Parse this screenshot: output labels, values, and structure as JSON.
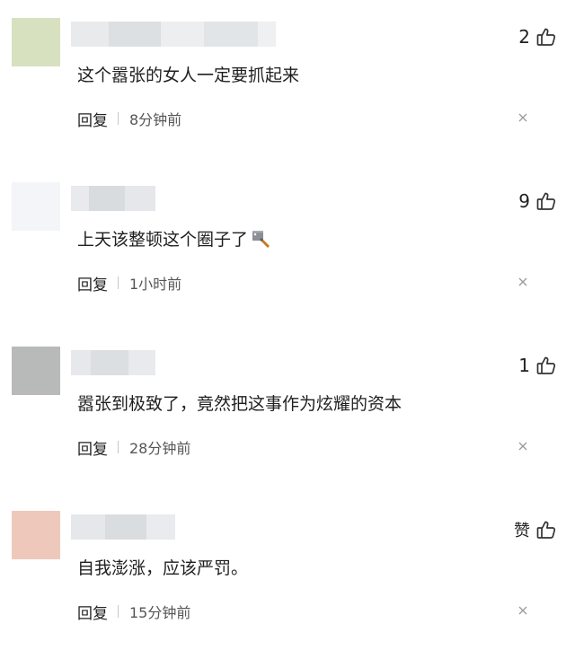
{
  "reply_label": "回复",
  "comments": [
    {
      "text": "这个嚣张的女人一定要抓起来",
      "time": "8分钟前",
      "likes": "2",
      "avatar_color": "#d7e1bf"
    },
    {
      "text": "上天该整顿这个圈子了",
      "time": "1小时前",
      "likes": "9",
      "avatar_color": "#f4f5f8"
    },
    {
      "text": "嚣张到极致了，竟然把这事作为炫耀的资本",
      "time": "28分钟前",
      "likes": "1",
      "avatar_color": "#b8b9b9"
    },
    {
      "text": "自我澎涨，应该严罚。",
      "time": "15分钟前",
      "likes": "赞",
      "avatar_color": "#eec9bb"
    }
  ],
  "icons": {
    "like": "thumbs-up-icon",
    "close": "close-icon",
    "emoji": "knife-emoji"
  }
}
